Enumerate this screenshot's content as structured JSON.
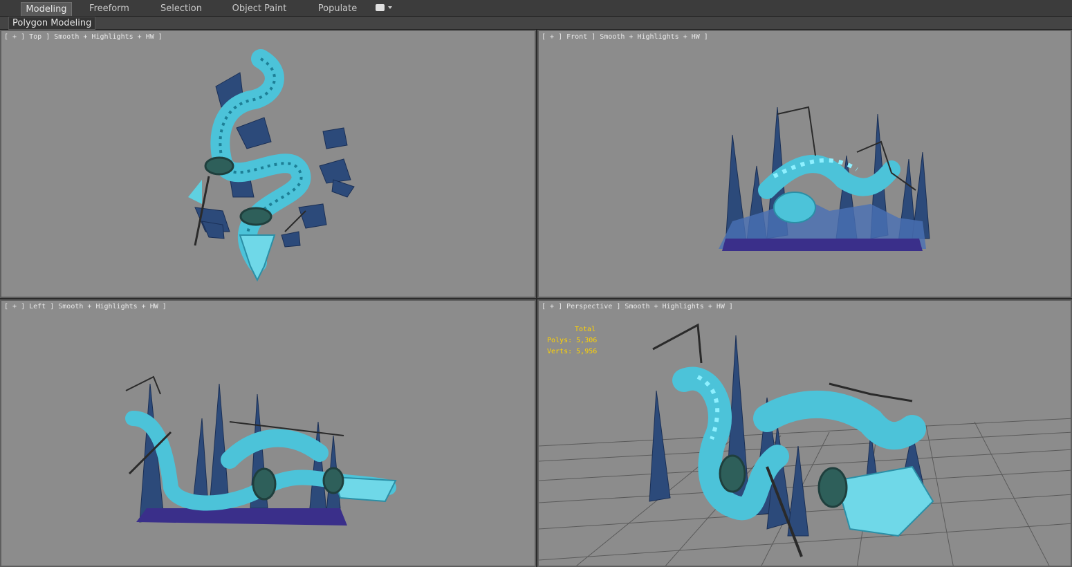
{
  "ribbon": {
    "tabs": [
      {
        "label": "Modeling",
        "active": true
      },
      {
        "label": "Freeform"
      },
      {
        "label": "Selection"
      },
      {
        "label": "Object Paint"
      },
      {
        "label": "Populate"
      }
    ],
    "panel_label": "Polygon Modeling"
  },
  "viewports": {
    "top": {
      "label": "[ + ] Top ] Smooth + Highlights + HW ]"
    },
    "front": {
      "label": "[ + ] Front ] Smooth + Highlights + HW ]"
    },
    "left": {
      "label": "[ + ] Left ] Smooth + Highlights + HW ]"
    },
    "perspective": {
      "label": "[ + ] Perspective ] Smooth + Highlights + HW ]"
    }
  },
  "stats": {
    "total_label": "Total",
    "polys_label": "Polys:",
    "polys_value": "5,306",
    "verts_label": "Verts:",
    "verts_value": "5,956"
  },
  "colors": {
    "viewport_bg": "#8c8c8c",
    "dragon": "#4cc3d9",
    "crystal_dark": "#24406e",
    "crystal_light": "#5b8fc7",
    "stats_text": "#ffd200"
  }
}
